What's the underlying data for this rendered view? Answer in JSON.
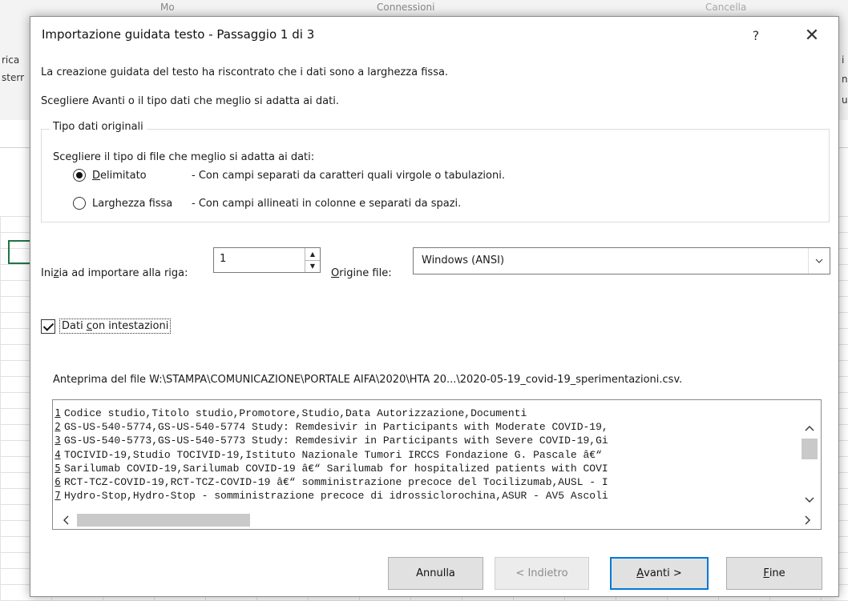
{
  "background": {
    "ribbon_fragments": [
      "rica",
      "sterr",
      "i",
      "n",
      "u",
      "Mo",
      "Connessioni",
      "Cancella"
    ]
  },
  "dialog": {
    "title": "Importazione guidata testo - Passaggio 1 di 3",
    "help_glyph": "?",
    "close_glyph": "✕",
    "message_1": "La creazione guidata del testo ha riscontrato che i dati sono a larghezza fissa.",
    "message_2": "Scegliere Avanti o il tipo dati che meglio si adatta ai dati.",
    "group_title": "Tipo dati originali",
    "choose_label": "Scegliere il tipo di file che meglio si adatta ai dati:",
    "options": [
      {
        "label_pre": "",
        "label_ul": "D",
        "label_post": "elimitato",
        "description": "- Con campi separati da caratteri quali virgole o tabulazioni.",
        "selected": true
      },
      {
        "label_pre": "Lar",
        "label_ul": "g",
        "label_post": "hezza fissa",
        "description": "- Con campi allineati in colonne e separati da spazi.",
        "selected": false
      }
    ],
    "start_row": {
      "label_pre": "Ini",
      "label_ul": "z",
      "label_post": "ia ad importare alla riga:",
      "value": "1"
    },
    "origin": {
      "label_ul": "O",
      "label_post": "rigine file:",
      "value": "Windows (ANSI)"
    },
    "headers_checkbox": {
      "label_pre": "Dati ",
      "label_ul": "c",
      "label_post": "on intestazioni",
      "checked": true
    },
    "preview_label": "Anteprima del file W:\\STAMPA\\COMUNICAZIONE\\PORTALE AIFA\\2020\\HTA 20...\\2020-05-19_covid-19_sperimentazioni.csv.",
    "preview_lines": [
      {
        "n": "1",
        "text": "Codice studio,Titolo studio,Promotore,Studio,Data Autorizzazione,Documenti"
      },
      {
        "n": "2",
        "text": "GS-US-540-5774,GS-US-540-5774 Study: Remdesivir in Participants with Moderate COVID-19,"
      },
      {
        "n": "3",
        "text": "GS-US-540-5773,GS-US-540-5773 Study: Remdesivir in Participants with Severe COVID-19,Gi"
      },
      {
        "n": "4",
        "text": "TOCIVID-19,Studio TOCIVID-19,Istituto Nazionale Tumori IRCCS  Fondazione G. Pascale â€“"
      },
      {
        "n": "5",
        "text": "Sarilumab COVID-19,Sarilumab COVID-19 â€“ Sarilumab for hospitalized patients with COVI"
      },
      {
        "n": "6",
        "text": "RCT-TCZ-COVID-19,RCT-TCZ-COVID-19 â€“ somministrazione precoce del Tocilizumab,AUSL - I"
      },
      {
        "n": "7",
        "text": "Hydro-Stop,Hydro-Stop - somministrazione precoce di idrossiclorochina,ASUR - AV5 Ascoli"
      }
    ],
    "buttons": {
      "cancel": "Annulla",
      "back": "< Indietro",
      "next_ul": "A",
      "next_post": "vanti >",
      "finish_ul": "F",
      "finish_post": "ine"
    }
  }
}
